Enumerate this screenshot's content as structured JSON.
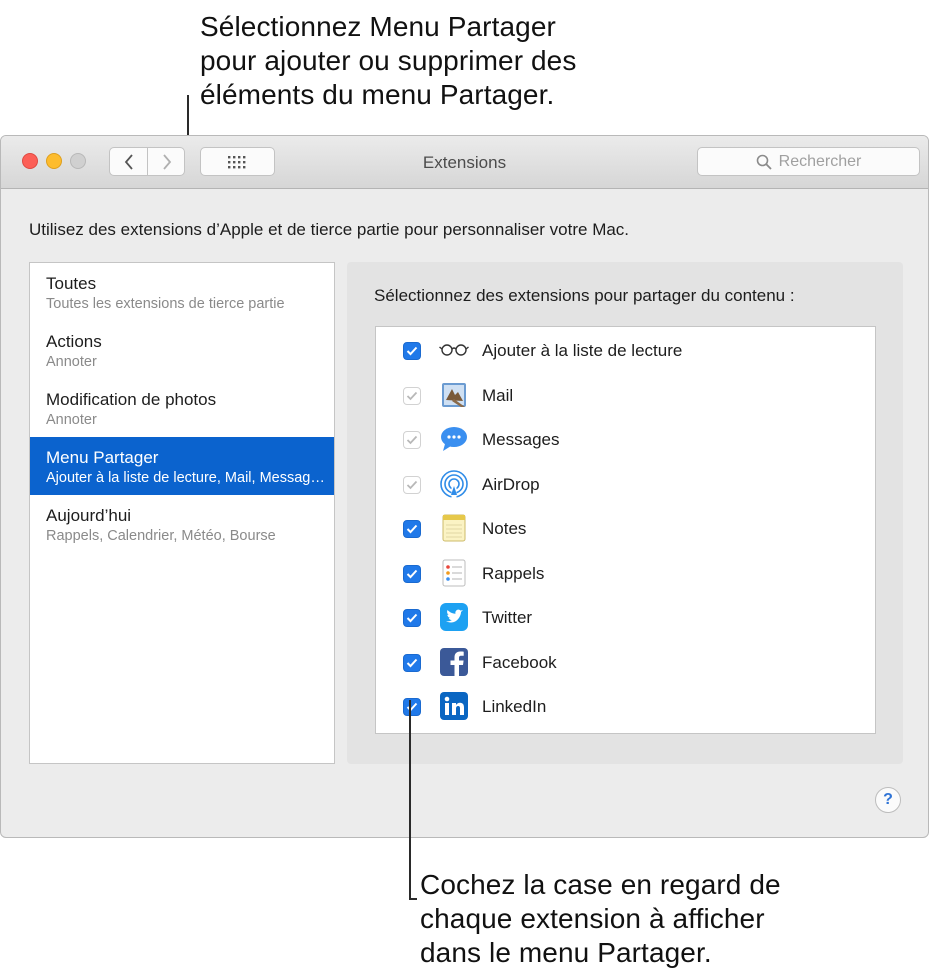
{
  "callouts": {
    "top": "Sélectionnez Menu Partager\npour ajouter ou supprimer des\néléments du menu Partager.",
    "bottom": "Cochez la case en regard de\nchaque extension à afficher\ndans le menu Partager."
  },
  "window": {
    "title": "Extensions",
    "search_placeholder": "Rechercher",
    "description": "Utilisez des extensions d’Apple et de tierce partie pour personnaliser votre Mac."
  },
  "sidebar": {
    "items": [
      {
        "title": "Toutes",
        "subtitle": "Toutes les extensions de tierce partie",
        "selected": false
      },
      {
        "title": "Actions",
        "subtitle": "Annoter",
        "selected": false
      },
      {
        "title": "Modification de photos",
        "subtitle": "Annoter",
        "selected": false
      },
      {
        "title": "Menu Partager",
        "subtitle": "Ajouter à la liste de lecture, Mail, Messages, AirDrop, Notes, Rappels, Twitter, Facebook, LinkedIn",
        "selected": true
      },
      {
        "title": "Aujourd’hui",
        "subtitle": "Rappels, Calendrier, Météo, Bourse",
        "selected": false
      }
    ]
  },
  "panel": {
    "label": "Sélectionnez des extensions pour partager du contenu :",
    "extensions": [
      {
        "label": "Ajouter à la liste de lecture",
        "icon": "glasses-icon",
        "checked": true,
        "enabled": true
      },
      {
        "label": "Mail",
        "icon": "mail-icon",
        "checked": true,
        "enabled": false
      },
      {
        "label": "Messages",
        "icon": "messages-icon",
        "checked": true,
        "enabled": false
      },
      {
        "label": "AirDrop",
        "icon": "airdrop-icon",
        "checked": true,
        "enabled": false
      },
      {
        "label": "Notes",
        "icon": "notes-icon",
        "checked": true,
        "enabled": true
      },
      {
        "label": "Rappels",
        "icon": "reminders-icon",
        "checked": true,
        "enabled": true
      },
      {
        "label": "Twitter",
        "icon": "twitter-icon",
        "checked": true,
        "enabled": true
      },
      {
        "label": "Facebook",
        "icon": "facebook-icon",
        "checked": true,
        "enabled": true
      },
      {
        "label": "LinkedIn",
        "icon": "linkedin-icon",
        "checked": true,
        "enabled": true
      }
    ]
  },
  "help": {
    "label": "?"
  },
  "colors": {
    "accent": "#0b63ce",
    "checkbox": "#2079e9",
    "twitter": "#1da1f2",
    "facebook": "#3b5998",
    "linkedin": "#0a66c2"
  }
}
